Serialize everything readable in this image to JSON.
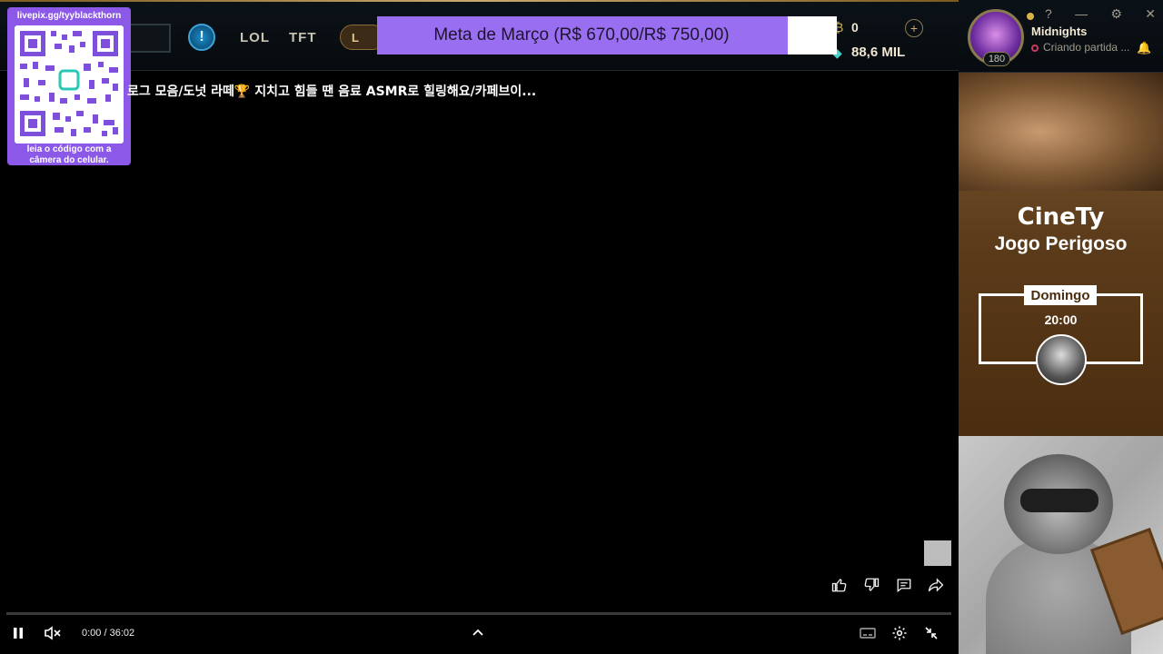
{
  "client": {
    "nav": {
      "lol": "LOL",
      "tft": "TFT",
      "loot": "L"
    },
    "alert_glyph": "!",
    "currency": {
      "rp": "0",
      "blue_essence": "88,6 MIL",
      "rp_icon": "₿",
      "be_icon": "◆",
      "plus": "+"
    },
    "profile": {
      "name": "Midnights",
      "level": "180",
      "status": "Criando partida ..."
    },
    "window_buttons": [
      "?",
      "—",
      "⚙",
      "✕"
    ]
  },
  "goal": {
    "text": "Meta de Março (R$ 670,00/R$ 750,00)",
    "progress": 0.893
  },
  "qr": {
    "url": "livepix.gg/tyyblackthorn",
    "caption_line1": "leia o código com a",
    "caption_line2": "câmera do celular."
  },
  "video": {
    "title": "로그 모음/도넛 라떼🏆 지치고 힘들 땐 음료 ASMR로 힐링해요/카페브이...",
    "time": "0:00 / 36:02",
    "actions": [
      "like-icon",
      "dislike-icon",
      "comment-icon",
      "share-icon"
    ],
    "colors": {
      "progress": "#3a3a3a"
    }
  },
  "promo": {
    "brand": "CineTy",
    "movie": "Jogo Perigoso",
    "day": "Domingo",
    "time": "20:00"
  },
  "colors": {
    "goal_fill": "#9a6ef0",
    "goal_bg": "#ffffff",
    "lol_gold": "#c8aa6e",
    "status_red": "#c83b5a"
  }
}
